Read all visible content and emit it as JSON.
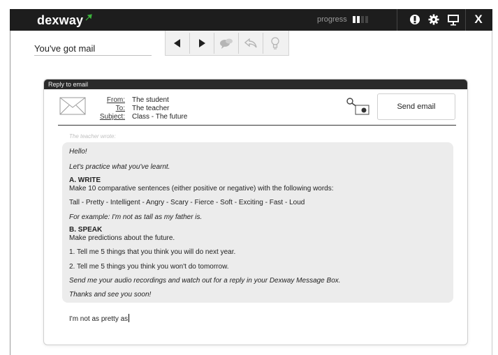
{
  "app": {
    "logo": "dexway",
    "progress_label": "progress",
    "progress_segments": [
      true,
      true,
      false,
      false
    ]
  },
  "colors": {
    "topbar": "#1d1d1d",
    "logo_arrow": "#3cb43c"
  },
  "page": {
    "title": "You've got mail"
  },
  "toolbar": {
    "icons": [
      "prev-arrow-icon",
      "next-arrow-icon",
      "chat-icon",
      "reply-icon",
      "lightbulb-icon"
    ]
  },
  "topbar_icons": [
    "info-icon",
    "settings-icon",
    "screen-icon",
    "close-icon"
  ],
  "topbar_close": "X",
  "email": {
    "header": "Reply to email",
    "from_label": "From:",
    "from_value": "The student",
    "to_label": "To:",
    "to_value": "The teacher",
    "subject_label": "Subject:",
    "subject_value": "Class - The future",
    "send_label": "Send email",
    "wrote_label": "The teacher wrote:",
    "body": {
      "l1": "Hello!",
      "l2": "Let's practice what you've learnt.",
      "l3": "A. WRITE",
      "l4": "Make 10 comparative sentences (either positive or negative) with the following words:",
      "l5": "Tall - Pretty - Intelligent - Angry - Scary - Fierce - Soft - Exciting - Fast - Loud",
      "l6": "For example: I'm not as tall as my father is.",
      "l7": "B. SPEAK",
      "l8": "Make predictions about the future.",
      "l9": "1. Tell me 5 things that you think you will do next year.",
      "l10": "2. Tell me 5 things you think you won't do tomorrow.",
      "l11": "Send me your audio recordings and watch out for a reply in your Dexway Message Box.",
      "l12": "Thanks and see you soon!"
    },
    "reply_text": "I'm not as pretty as"
  }
}
